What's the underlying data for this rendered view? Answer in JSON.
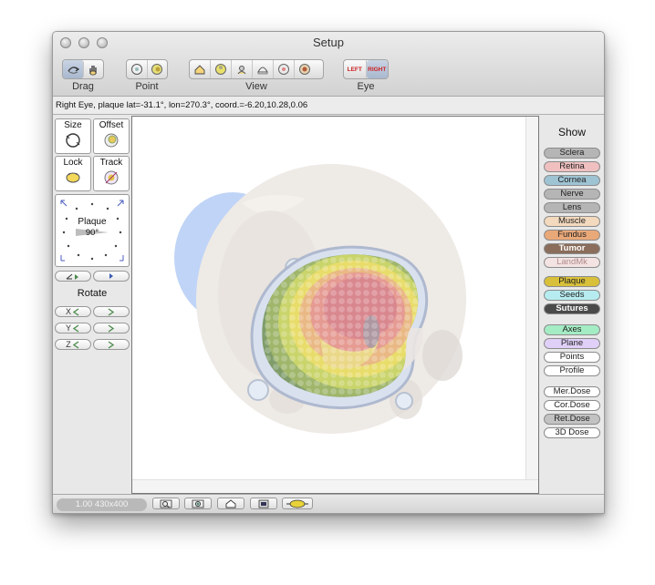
{
  "window": {
    "title": "Setup"
  },
  "toolbar": {
    "groups": [
      {
        "label": "Drag",
        "icons": [
          "rotate-drag-icon",
          "hand-drag-icon"
        ]
      },
      {
        "label": "Point",
        "icons": [
          "point-eye-icon",
          "point-target-icon"
        ]
      },
      {
        "label": "View",
        "icons": [
          "view-home-icon",
          "view-top-icon",
          "view-side-icon",
          "view-bottom-icon",
          "view-front-icon",
          "view-back-icon"
        ]
      },
      {
        "label": "Eye",
        "left": "LEFT",
        "right": "RIGHT"
      }
    ]
  },
  "status": {
    "text": "Right Eye, plaque lat=-31.1°, lon=270.3°, coord.=-6.20,10.28,0.06"
  },
  "left_panel": {
    "size_label": "Size",
    "offset_label": "Offset",
    "lock_label": "Lock",
    "track_label": "Track",
    "plaque_label": "Plaque",
    "plaque_angle": "90°",
    "rotate_label": "Rotate",
    "axes": [
      "X",
      "Y",
      "Z"
    ]
  },
  "right_panel": {
    "title": "Show",
    "layers": [
      {
        "label": "Sclera",
        "color": "#b5b5b5"
      },
      {
        "label": "Retina",
        "color": "#f0c0c0"
      },
      {
        "label": "Cornea",
        "color": "#9ec3d3"
      },
      {
        "label": "Nerve",
        "color": "#b5b5b5"
      },
      {
        "label": "Lens",
        "color": "#b5b5b5"
      },
      {
        "label": "Muscle",
        "color": "#f3d9bd"
      },
      {
        "label": "Fundus",
        "color": "#e9a878"
      },
      {
        "label": "Tumor",
        "color": "#8a6d5a",
        "light_text": true
      },
      {
        "label": "LandMk",
        "color": "#f4e3e3",
        "dim_text": true
      }
    ],
    "layers2": [
      {
        "label": "Plaque",
        "color": "#d8c03a"
      },
      {
        "label": "Seeds",
        "color": "#b6ecf0"
      },
      {
        "label": "Sutures",
        "color": "#4a4a4a",
        "light_text": true
      }
    ],
    "layers3": [
      {
        "label": "Axes",
        "color": "#a4ecc4"
      },
      {
        "label": "Plane",
        "color": "#e0d0f8"
      },
      {
        "label": "Points",
        "color": "#ffffff"
      },
      {
        "label": "Profile",
        "color": "#ffffff"
      }
    ],
    "layers4": [
      {
        "label": "Mer.Dose",
        "color": "#ffffff"
      },
      {
        "label": "Cor.Dose",
        "color": "#ffffff"
      },
      {
        "label": "Ret.Dose",
        "color": "#c2c2c2"
      },
      {
        "label": "3D Dose",
        "color": "#ffffff"
      }
    ]
  },
  "bottom_bar": {
    "zoom_text": "1.00 430x400"
  }
}
